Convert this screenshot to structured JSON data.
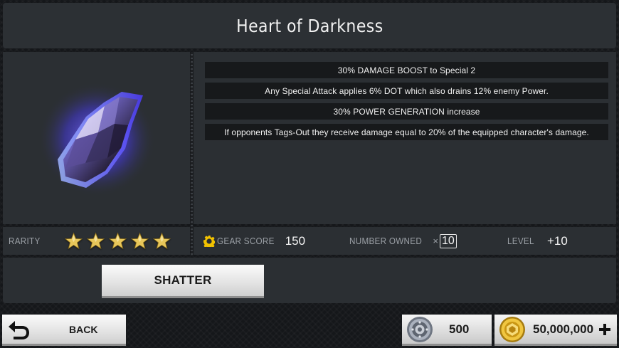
{
  "header": {
    "title": "Heart of Darkness"
  },
  "item": {
    "icon": "dark-crystal-shard-icon",
    "glow_color": "#6b5cff"
  },
  "stats": [
    {
      "text": "30% DAMAGE BOOST to Special 2"
    },
    {
      "text": "Any Special Attack applies 6% DOT which also drains 12% enemy Power."
    },
    {
      "text": "30% POWER GENERATION increase"
    },
    {
      "text": "If opponents Tags-Out they receive damage equal to 20% of the equipped character's damage."
    }
  ],
  "rarity": {
    "label": "RARITY",
    "stars": 5,
    "star_color": "#e7c65a"
  },
  "info": {
    "gear_score_label": "GEAR SCORE",
    "gear_score_value": "150",
    "gear_icon_color": "#f2c200",
    "number_owned_label": "NUMBER OWNED",
    "number_owned_prefix": "×",
    "number_owned_value": "10",
    "level_label": "LEVEL",
    "level_value": "+10"
  },
  "actions": {
    "shatter_label": "SHATTER"
  },
  "footer": {
    "back_label": "BACK",
    "currency_silver": {
      "icon": "silver-coin-icon",
      "value": "500"
    },
    "currency_gold": {
      "icon": "gold-coin-icon",
      "value": "50,000,000"
    }
  }
}
